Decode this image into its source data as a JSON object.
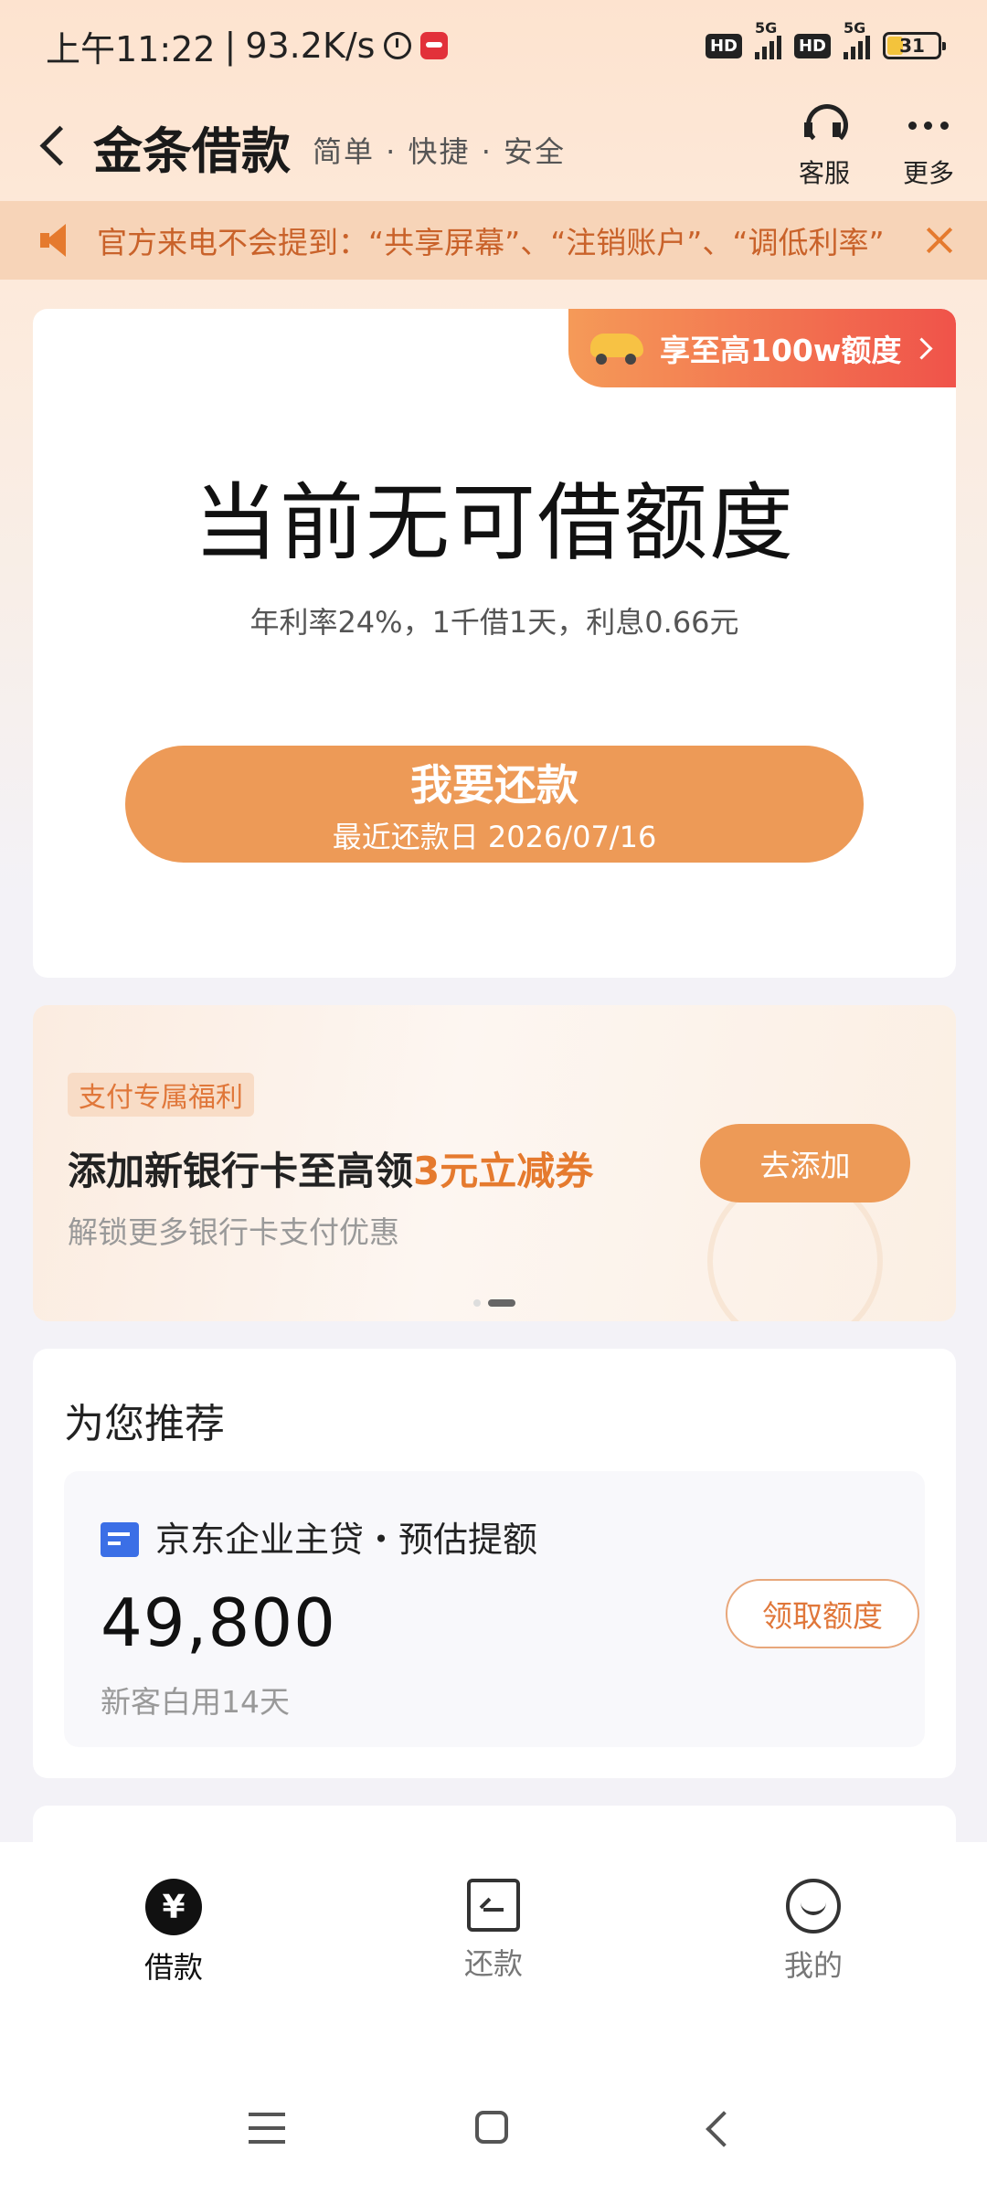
{
  "status_bar": {
    "time": "上午11:22",
    "speed": "93.2K/s",
    "hd_label": "HD",
    "network_1": "5G",
    "network_2": "5G",
    "battery": "31"
  },
  "header": {
    "title": "金条借款",
    "subtitle": "简单 · 快捷 · 安全",
    "support_label": "客服",
    "more_label": "更多"
  },
  "notice": {
    "text": "官方来电不会提到：“共享屏幕”、“注销账户”、“调低利率”"
  },
  "main_card": {
    "promo": "享至高100w额度",
    "headline": "当前无可借额度",
    "rate_info": "年利率24%，1千借1天，利息0.66元",
    "repay_button": "我要还款",
    "repay_date": "最近还款日 2026/07/16"
  },
  "benefit": {
    "tag": "支付专属福利",
    "title_prefix": "添加新银行卡至高领",
    "title_highlight": "3元立减券",
    "subtitle": "解锁更多银行卡支付优惠",
    "button": "去添加"
  },
  "recommend": {
    "section_title": "为您推荐",
    "item_name": "京东企业主贷・预估提额",
    "amount": "49,800",
    "note": "新客白用14天",
    "button": "领取额度"
  },
  "tabbar": {
    "tabs": [
      {
        "label": "借款",
        "icon": "yen-icon",
        "active": true
      },
      {
        "label": "还款",
        "icon": "repay-icon",
        "active": false
      },
      {
        "label": "我的",
        "icon": "smile-icon",
        "active": false
      }
    ],
    "loan_symbol": "¥"
  },
  "colors": {
    "accent": "#ed9a57",
    "promo_gradient_start": "#f59a58",
    "promo_gradient_end": "#f0534a",
    "notice_text": "#c9622a"
  }
}
